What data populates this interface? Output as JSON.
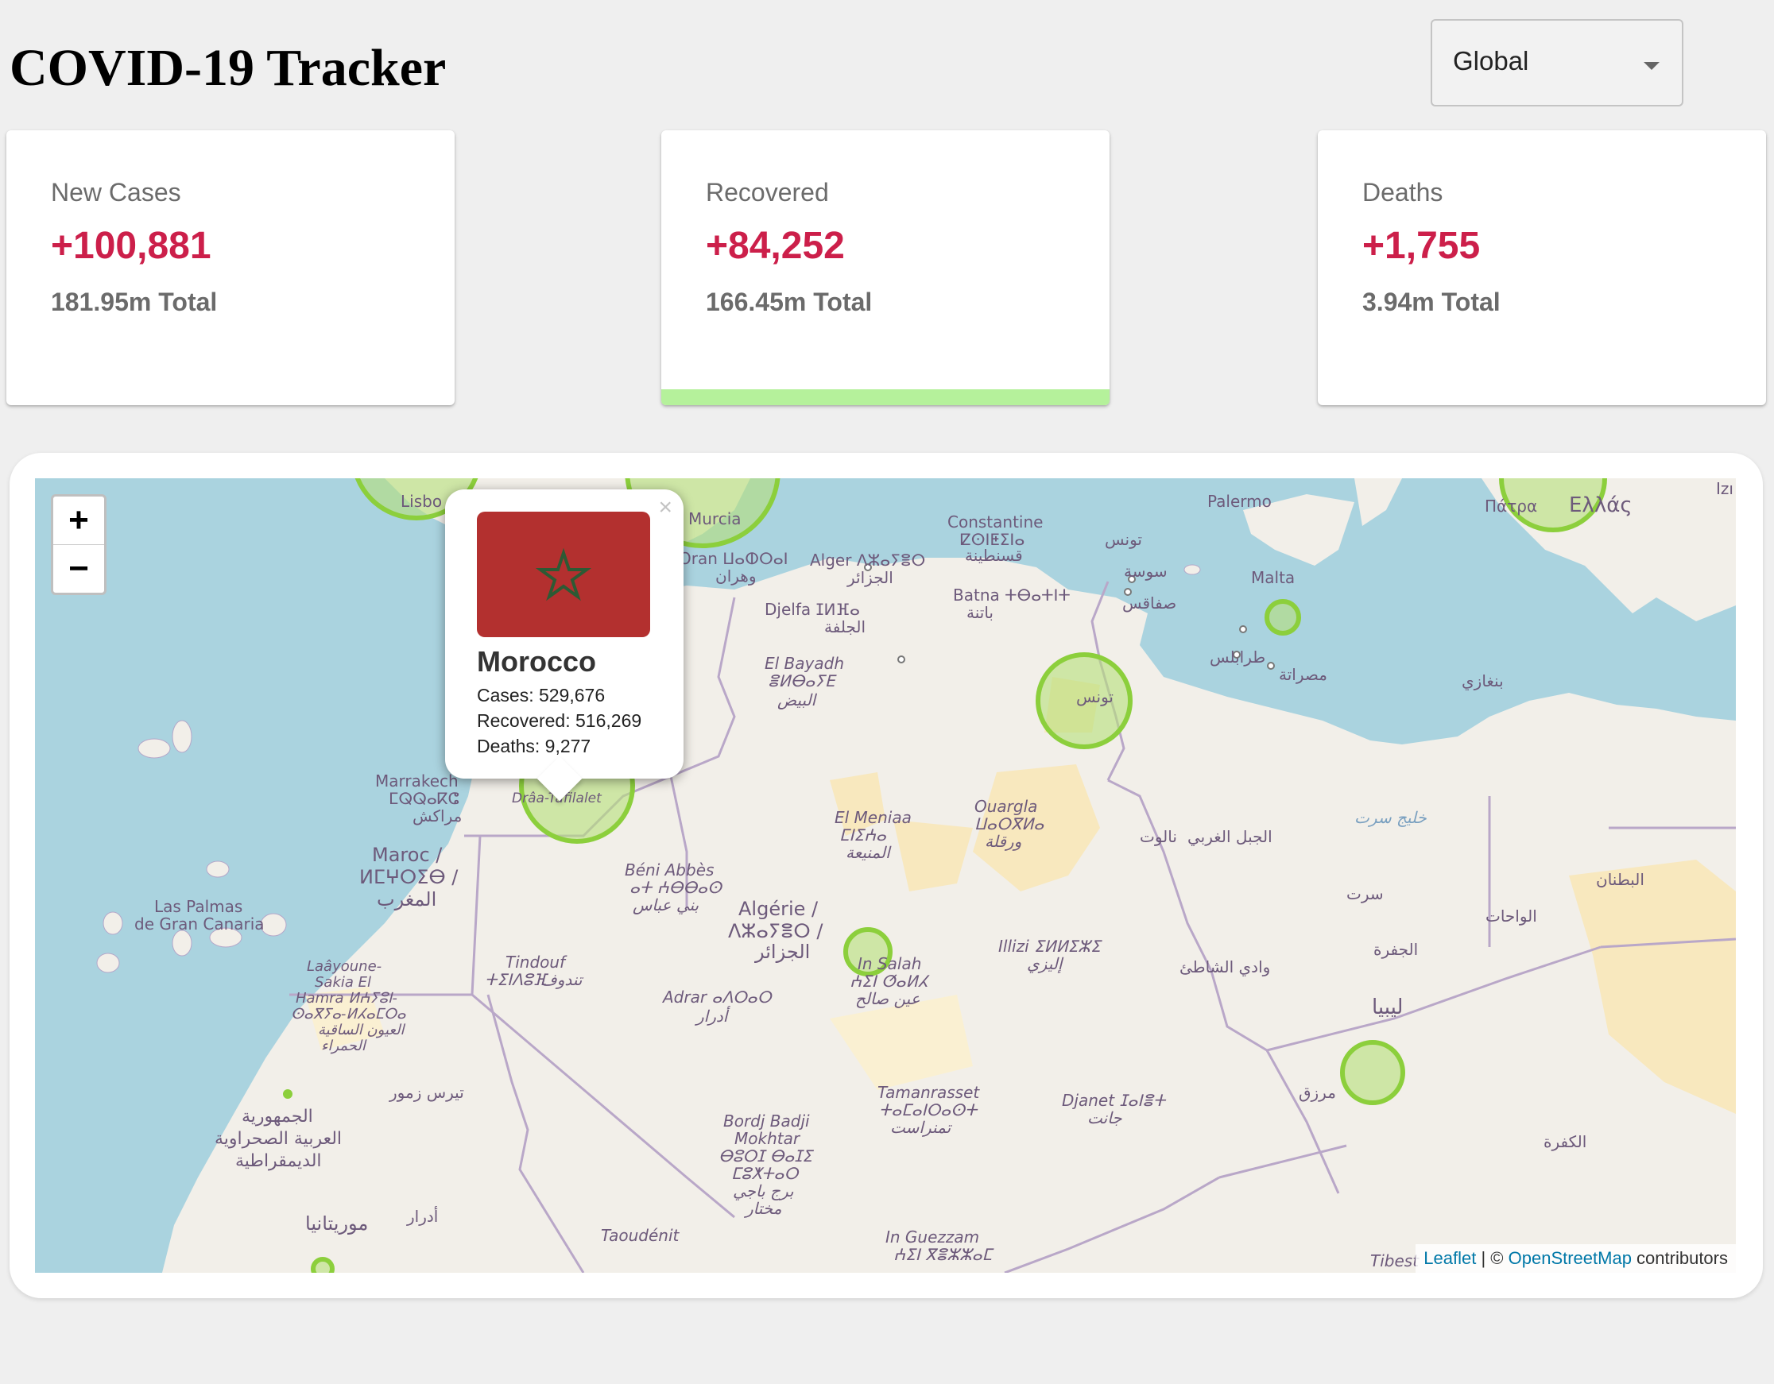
{
  "app": {
    "title": "COVID-19 Tracker"
  },
  "country_select": {
    "value": "Global"
  },
  "cards": [
    {
      "label": "New Cases",
      "value": "+100,881",
      "total": "181.95m Total",
      "active": false
    },
    {
      "label": "Recovered",
      "value": "+84,252",
      "total": "166.45m Total",
      "active": true
    },
    {
      "label": "Deaths",
      "value": "+1,755",
      "total": "3.94m Total",
      "active": false
    }
  ],
  "colors": {
    "value_red": "#cc1f4a",
    "active_bar": "#b5f19b",
    "circle_stroke": "#8ccf3c",
    "circle_fill": "#b6e07a",
    "sea": "#aad3df",
    "land": "#f2efe9"
  },
  "map": {
    "zoom_in": "+",
    "zoom_out": "−",
    "attribution": {
      "leaflet": "Leaflet",
      "separator": " | © ",
      "osm": "OpenStreetMap",
      "suffix": " contributors"
    },
    "labels": [
      "Palermo",
      "Πάτρα",
      "Ελλάς",
      "Izı",
      "Lisbo",
      "Murcia",
      "Constantine",
      "ⵇⵙⵏⵟⵉⵏⴰ",
      "قسنطينة",
      "تونس",
      "Oran ⵡⴰⵀⵔⴰⵏ",
      "وهران",
      "Alger ⴷⵣⴰⵢⴻⵔ",
      "الجزائر",
      "سوسة",
      "Malta",
      "Djelfa ⵊⵍⴼⴰ",
      "الجلفة",
      "Batna ⵜⴱⴰⵜⵏⵜ",
      "باتنة",
      "صفاقس",
      "تونس",
      "El Bayadh",
      "ⴻⵍⴱⴰⵢⴹ",
      "البيض",
      "طرابلس",
      "مصراتة",
      "بنغازي",
      "Marrakech",
      "ⵎⵕⵕⴰⴽⵛ",
      "مراكش",
      "Drâa-Tafilalet",
      "El Meniaa",
      "ⵎⵏⵉⵄⴰ",
      "المنيعة",
      "Ouargla",
      "ⵡⴰⵔⴳⵍⴰ",
      "ورقلة",
      "نالوت",
      "الجبل الغربي",
      "خليج سرت",
      "سرت",
      "البطنان",
      "الواحات",
      "Maroc /",
      "ⵍⵎⵖⵔⵉⴱ /",
      "المغرب",
      "Las Palmas",
      "de Gran Canaria",
      "Béni Abbès",
      "ⴰⵜ ⵄⴱⴱⴰⵙ",
      "بني عباس",
      "Algérie /",
      "ⴷⵣⴰⵢⴻⵔ /",
      "الجزائر",
      "Illizi ⵉⵍⵍⵉⵣⵉ",
      "إليزي",
      "وادي الشاطئ",
      "الجفرة",
      "Laâyoune-",
      "Sakia El",
      "Hamra ⵍⵄⵢⵓⵏ-",
      "ⵙⴰⴳⵢⴰ-ⵍⵃⴰⵎⵔⴰ",
      "العيون الساقية",
      "الحمراء",
      "Tindouf",
      "ⵜⵉⵏⴷⵓⴼ",
      "تندوف",
      "In Salah",
      "ⵄⵉⵏ ⵚⴰⵍⵃ",
      "عين صالح",
      "Adrar ⴰⴷⵔⴰⵔ",
      "أدرار",
      "ليبيا",
      "الجمهورية",
      "العربية الصحراوية",
      "الديمقراطية",
      "تيرس زمور",
      "Tamanrasset",
      "ⵜⴰⵎⴰⵏⵔⴰⵙⵜ",
      "تمنراست",
      "Djanet ⵊⴰⵏⴻⵜ",
      "جانت",
      "مرزق",
      "Bordj Badji",
      "Mokhtar",
      "ⴱⵓⵔⵊ ⴱⴰⵊⵉ",
      "ⵎⵓⵅⵜⴰⵔ",
      "برج باجي",
      "مختار",
      "الكفرة",
      "موريتانيا",
      "أدرار",
      "Taoudénit",
      "In Guezzam",
      "ⵄⵉⵏ ⴳⴻⵣⵣⴰⵎ",
      "Tibest"
    ],
    "popup": {
      "close": "×",
      "country": "Morocco",
      "cases": "Cases: 529,676",
      "recovered": "Recovered: 516,269",
      "deaths": "Deaths: 9,277"
    }
  }
}
